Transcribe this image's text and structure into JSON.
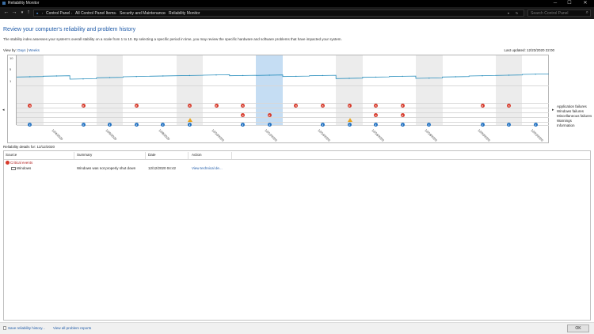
{
  "window": {
    "title": "Reliability Monitor",
    "minimize": "─",
    "maximize": "☐",
    "close": "✕"
  },
  "nav": {
    "back": "←",
    "forward": "→",
    "up": "↑",
    "breadcrumbs": [
      "Control Panel",
      "All Control Panel Items",
      "Security and Maintenance",
      "Reliability Monitor"
    ],
    "search_placeholder": "Search Control Panel"
  },
  "header": {
    "title": "Review your computer's reliability and problem history",
    "description": "The stability index assesses your system's overall stability on a scale from 1 to 10. By selecting a specific period in time, you may review the specific hardware and software problems that have impacted your system.",
    "view_by_label": "View by:",
    "view_days": "Days",
    "view_sep": "|",
    "view_weeks": "Weeks",
    "last_updated": "Last updated: 12/23/2020 22:00"
  },
  "chart_data": {
    "type": "line",
    "title": "",
    "ylabel": "",
    "ylim": [
      1,
      10
    ],
    "yticks": [
      "10",
      "5",
      "1"
    ],
    "x": [
      "12/3/2020",
      "12/4/2020",
      "12/5/2020",
      "12/6/2020",
      "12/7/2020",
      "12/8/2020",
      "12/9/2020",
      "12/10/2020",
      "12/11/2020",
      "12/12/2020",
      "12/13/2020",
      "12/14/2020",
      "12/15/2020",
      "12/16/2020",
      "12/17/2020",
      "12/18/2020",
      "12/19/2020",
      "12/20/2020",
      "12/21/2020",
      "12/22/2020"
    ],
    "date_labels": [
      "12/4/2020",
      "12/6/2020",
      "12/8/2020",
      "12/10/2020",
      "12/12/2020",
      "12/14/2020",
      "12/16/2020",
      "12/18/2020",
      "12/20/2020",
      "12/22/2020"
    ],
    "series": [
      {
        "values": [
          2.4,
          2.7,
          1.6,
          2.1,
          2.5,
          2.7,
          2.9,
          3.1,
          2.9,
          3.0,
          2.6,
          2.9,
          1.8,
          2.3,
          2.6,
          1.9,
          2.4,
          2.8,
          3.0,
          3.4
        ]
      }
    ],
    "selected_index": 9,
    "event_rows": [
      "Application failures",
      "Windows failures",
      "Miscellaneous failures",
      "Warnings",
      "Information"
    ],
    "events": {
      "app_failures": [
        0,
        2,
        4,
        6,
        7,
        8,
        10,
        11,
        12,
        13,
        14,
        17,
        18
      ],
      "windows_failures": [
        8,
        9,
        13,
        14
      ],
      "misc_failures": [],
      "warnings": [
        6,
        12
      ],
      "information": [
        0,
        2,
        3,
        4,
        5,
        6,
        8,
        9,
        11,
        12,
        13,
        14,
        15,
        17,
        18,
        19
      ]
    }
  },
  "details": {
    "title": "Reliability details for: 12/12/2020",
    "columns": [
      "Source",
      "Summary",
      "Date",
      "Action"
    ],
    "group": "Critical events",
    "rows": [
      {
        "source": "Windows",
        "summary": "Windows was not properly shut down",
        "date": "12/12/2020 04:42",
        "action": "View technical de..."
      }
    ]
  },
  "footer": {
    "save_history": "Save reliability history...",
    "view_all": "View all problem reports",
    "ok": "OK"
  }
}
